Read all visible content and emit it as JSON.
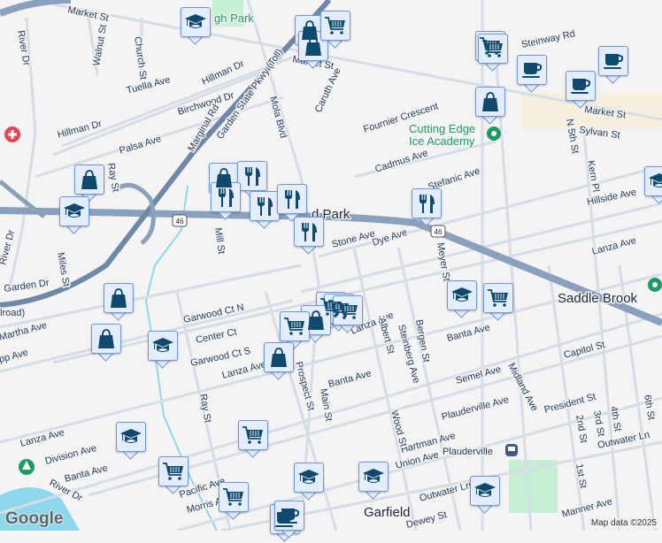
{
  "places": {
    "garfield": "Garfield",
    "saddle_brook": "Saddle Brook",
    "plauderville": "Plauderville",
    "park": "gh Park",
    "park_town": "d Park"
  },
  "pois": {
    "ice1": "Cutting Edge",
    "ice2": "Ice Academy"
  },
  "route_shield": "46",
  "streets": {
    "market_w": "Market St",
    "market_c": "Market St",
    "market_e": "Market St",
    "walnut": "Walnut St",
    "church": "Church St",
    "tuella": "Tuella Ave",
    "hillman1": "Hillman Dr",
    "hillman2": "Hillman Dr",
    "birchwood": "Birchwood Dr",
    "palsa": "Palsa Ave",
    "marginal": "Marginal Rd",
    "gsp": "Garden State Pkwy (Toll)",
    "mola": "Mola Blvd",
    "ray1": "Ray St",
    "river1": "River Dr",
    "river2": "River Dr",
    "river3": "River Dr",
    "mill": "Mill St",
    "miles": "Miles St",
    "garden": "Garden Dr",
    "railroad": "lroad)",
    "martha": "Martha Ave",
    "opp": "pp Ave",
    "garwood_n": "Garwood Ct N",
    "center": "Center Ct",
    "garwood_s": "Garwood Ct S",
    "lanza1": "Lanza Ave",
    "lanza2": "Lanza Ave",
    "lanza3": "Lanza Ave",
    "lanza4": "Lanza Ave",
    "ray2": "Ray St",
    "prospect": "Prospect St",
    "main": "Main St",
    "banta1": "Banta Ave",
    "banta2": "Banta Ave",
    "banta3": "Banta Ave",
    "division": "Division Ave",
    "pacific": "Pacific Ave",
    "morris": "Morris Ave",
    "caruth": "Caruth Ave",
    "fournier": "Fournier Crescent",
    "cadmus": "Cadmus Ave",
    "stefanic": "Stefanic Ave",
    "stone": "Stone Ave",
    "dye": "Dye Ave",
    "meyer": "Meyer St",
    "steinway": "Steinway Rd",
    "n5th": "N 5th St",
    "sylvan": "Sylvan St",
    "kern": "Kern Pl",
    "hillside": "Hillside Ave",
    "albert": "Albert St",
    "steinberg": "Steinberg Ave",
    "bergen": "Bergen St",
    "semel": "Semel Ave",
    "plauderville": "Plauderville Ave",
    "midland": "Midland Ave",
    "president": "President St",
    "capitol": "Capitol St",
    "hartman": "Hartman Ave",
    "union": "Union Ave",
    "wood": "Wood St",
    "outwater1": "Outwater Ln",
    "outwater2": "Outwater Ln",
    "dewey": "Dewey St",
    "manner": "Manner Ave",
    "s1st": "1st St",
    "s2nd": "2nd St",
    "s3rd": "3rd St",
    "s4th": "4th St",
    "s6th": "6th St"
  },
  "markers": [
    {
      "type": "school"
    },
    {
      "type": "bag"
    },
    {
      "type": "bag"
    },
    {
      "type": "cart"
    },
    {
      "type": "cart"
    },
    {
      "type": "cart"
    },
    {
      "type": "coffee"
    },
    {
      "type": "coffee"
    },
    {
      "type": "coffee"
    },
    {
      "type": "bag"
    },
    {
      "type": "school"
    },
    {
      "type": "restaurant"
    },
    {
      "type": "bag"
    },
    {
      "type": "school"
    },
    {
      "type": "bag"
    },
    {
      "type": "restaurant"
    },
    {
      "type": "restaurant"
    },
    {
      "type": "restaurant"
    },
    {
      "type": "restaurant"
    },
    {
      "type": "restaurant"
    },
    {
      "type": "bag"
    },
    {
      "type": "bag"
    },
    {
      "type": "school"
    },
    {
      "type": "cart"
    },
    {
      "type": "cart"
    },
    {
      "type": "cart"
    },
    {
      "type": "bag"
    },
    {
      "type": "cart"
    },
    {
      "type": "bag"
    },
    {
      "type": "school"
    },
    {
      "type": "cart"
    },
    {
      "type": "school"
    },
    {
      "type": "cart"
    },
    {
      "type": "cart"
    },
    {
      "type": "cart"
    },
    {
      "type": "school"
    },
    {
      "type": "coffee"
    },
    {
      "type": "coffee"
    },
    {
      "type": "school"
    },
    {
      "type": "school"
    }
  ],
  "colors": {
    "icon": "#0f4a6e",
    "marker_bg": "#e4edfc",
    "marker_border": "#6f97d9",
    "highway": "#8aa1bd",
    "road": "#d5dde6",
    "water": "#8fd7ea",
    "park": "#c4efd3"
  },
  "attribution": {
    "logo": "Google",
    "map_data": "Map data ©2025"
  }
}
